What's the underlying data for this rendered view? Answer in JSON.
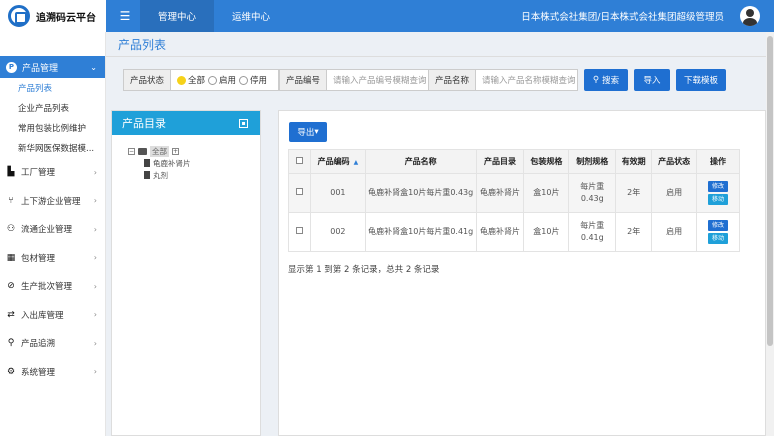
{
  "app": {
    "title": "追溯码云平台"
  },
  "header": {
    "menu_icon": "hamburger-icon",
    "tabs": [
      {
        "label": "管理中心",
        "active": true
      },
      {
        "label": "运维中心",
        "active": false
      }
    ],
    "user": "日本株式会社集团/日本株式会社集团超级管理员"
  },
  "sidebar": {
    "group": {
      "label": "产品管理",
      "icon": "P"
    },
    "sub_items": [
      "产品列表",
      "企业产品列表",
      "常用包装比例维护",
      "新华网医保数据模..."
    ],
    "items": [
      {
        "label": "工厂管理",
        "icon": "factory-icon"
      },
      {
        "label": "上下游企业管理",
        "icon": "network-icon"
      },
      {
        "label": "流通企业管理",
        "icon": "users-icon"
      },
      {
        "label": "包材管理",
        "icon": "grid-icon"
      },
      {
        "label": "生产批次管理",
        "icon": "pill-icon"
      },
      {
        "label": "入出库管理",
        "icon": "exchange-icon"
      },
      {
        "label": "产品追溯",
        "icon": "search-icon"
      },
      {
        "label": "系统管理",
        "icon": "gear-icon"
      }
    ]
  },
  "page": {
    "title": "产品列表"
  },
  "filters": {
    "status_label": "产品状态",
    "status_options": [
      "全部",
      "启用",
      "停用"
    ],
    "code_label": "产品编号",
    "code_placeholder": "请输入产品编号模糊查询",
    "name_label": "产品名称",
    "name_placeholder": "请输入产品名称模糊查询",
    "search": "搜索",
    "import": "导入",
    "download": "下载模板"
  },
  "catalog": {
    "title": "产品目录",
    "root": "全部",
    "children": [
      "龟鹿补肾片",
      "丸剂"
    ]
  },
  "table": {
    "export": "导出",
    "headers": [
      "产品编码",
      "产品名称",
      "产品目录",
      "包装规格",
      "制剂规格",
      "有效期",
      "产品状态",
      "操作"
    ],
    "rows": [
      {
        "code": "001",
        "name": "龟鹿补肾盒10片每片重0.43g",
        "catalog": "龟鹿补肾片",
        "pack": "盒10片",
        "spec": "每片重0.43g",
        "expiry": "2年",
        "status": "启用"
      },
      {
        "code": "002",
        "name": "龟鹿补肾盒10片每片重0.41g",
        "catalog": "龟鹿补肾片",
        "pack": "盒10片",
        "spec": "每片重0.41g",
        "expiry": "2年",
        "status": "启用"
      }
    ],
    "edit": "修改",
    "move": "移动",
    "summary": "显示第 1 到第 2 条记录，总共 2 条记录"
  },
  "colors": {
    "primary": "#2f7fd6",
    "accent": "#1fa0d9",
    "highlight": "#f6d21a"
  }
}
